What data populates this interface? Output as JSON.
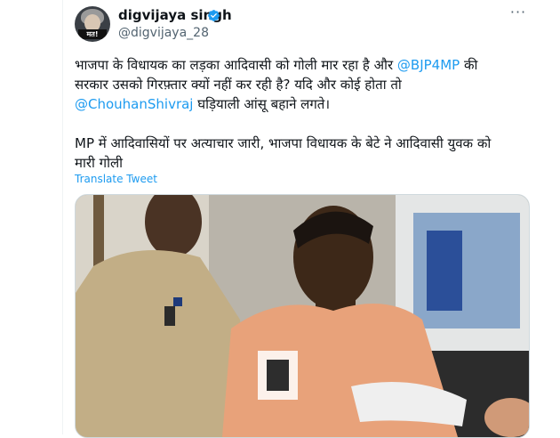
{
  "author": {
    "name": "digvijaya singh",
    "handle": "@digvijaya_28",
    "avatar_tag": "मत!"
  },
  "tweet": {
    "line1_text": "भाजपा के विधायक का लड़का आदिवासी को गोली मार रहा है और ",
    "line1_mention": "@BJP4MP",
    "line1_tail": " की",
    "line2": "सरकार उसको गिरफ़्तार क्यों नहीं कर रही है? यदि और कोई होता तो",
    "line3_mention": "@ChouhanShivraj",
    "line3_tail": " घड़ियाली आंसू बहाने लगते।",
    "line4": "MP में आदिवासियों पर अत्याचार जारी, भाजपा विधायक के बेटे ने आदिवासी युवक को",
    "line5": "मारी गोली"
  },
  "translate_label": "Translate Tweet",
  "icons": {
    "verified": "verified-badge-icon",
    "more": "more-options-icon"
  },
  "colors": {
    "accent": "#1d9bf0",
    "text": "#0f1419",
    "muted": "#536471"
  }
}
